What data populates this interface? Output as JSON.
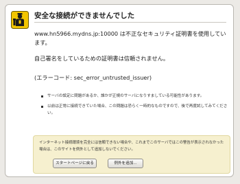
{
  "error": {
    "title": "安全な接続ができませんでした",
    "description": "www.hn5966.mydns.jp:10000 は不正なセキュリティ証明書を使用しています。",
    "cert_trust": "自己署名をしているための証明書は信頼されません。",
    "error_code": "(エラーコード: sec_error_untrusted_issuer)"
  },
  "bullets": [
    "サーバの設定に問題があるか、誰かが正規のサーバになりすましている可能性があります。",
    "以前は正常に接続できていた場合、この問題は恐らく一時的なものですので、後で再度試してみてください。"
  ],
  "advice": {
    "text": "インターネット接続環境を完全には信頼できない場合や、これまでこのサーバではこの警告が表示されなかった場合は、このサイトを例外として追加しないでください。",
    "start_page_button": "スタートページに戻る",
    "add_exception_button": "例外を追加..."
  },
  "icons": {
    "warning": "policeman-warning-icon"
  },
  "colors": {
    "background": "#eceae6",
    "advice_background": "#f6f0cf",
    "icon_yellow": "#f2c500"
  }
}
